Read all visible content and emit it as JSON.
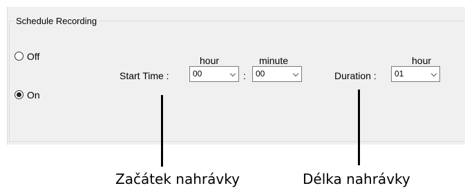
{
  "group": {
    "title": "Schedule Recording"
  },
  "mode": {
    "off_label": "Off",
    "on_label": "On",
    "selected": "On"
  },
  "start_time": {
    "label": "Start Time :",
    "hour_header": "hour",
    "minute_header": "minute",
    "hour_value": "00",
    "separator": ":",
    "minute_value": "00"
  },
  "duration": {
    "label": "Duration :",
    "hour_header": "hour",
    "hour_value": "01"
  },
  "annotations": {
    "start_time_caption": "Začátek nahrávky",
    "duration_caption": "Délka nahrávky"
  }
}
